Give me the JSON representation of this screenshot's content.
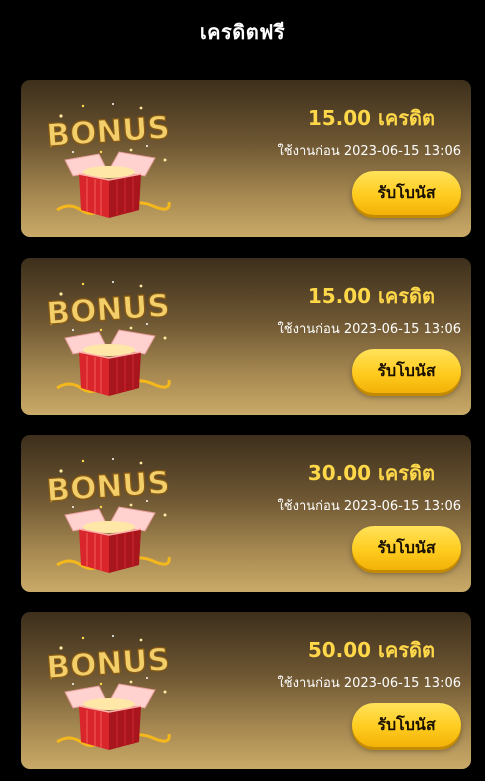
{
  "header": {
    "title": "เครดิตฟรี"
  },
  "bonuses": [
    {
      "amount": "15.00 เครดิต",
      "expiry": "ใช้งานก่อน 2023-06-15 13:06",
      "claim_label": "รับโบนัส"
    },
    {
      "amount": "15.00 เครดิต",
      "expiry": "ใช้งานก่อน 2023-06-15 13:06",
      "claim_label": "รับโบนัส"
    },
    {
      "amount": "30.00 เครดิต",
      "expiry": "ใช้งานก่อน 2023-06-15 13:06",
      "claim_label": "รับโบนัส"
    },
    {
      "amount": "50.00 เครดิต",
      "expiry": "ใช้งานก่อน 2023-06-15 13:06",
      "claim_label": "รับโบนัส"
    }
  ],
  "icons": {
    "bonus_art": "bonus-gift-box-icon"
  },
  "colors": {
    "background": "#000000",
    "amount_text": "#ffd84a",
    "button": "#ffcc1f",
    "card_top": "#3d2f1c",
    "card_bottom": "#c9aa68"
  }
}
